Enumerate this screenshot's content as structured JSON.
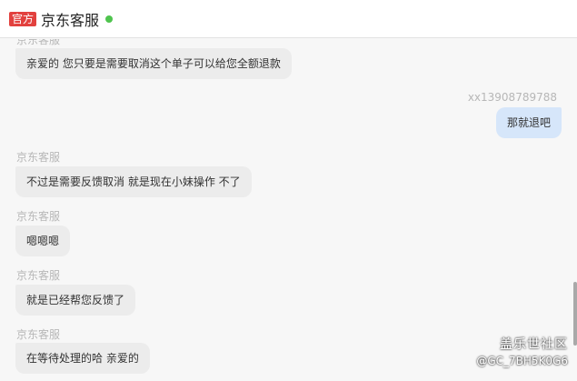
{
  "header": {
    "badge": "官方",
    "title": "京东客服",
    "status_color": "#4fc44e"
  },
  "messages": [
    {
      "sender": "京东客服",
      "text": "亲爱的 您只要是需要取消这个单子可以给您全额退款",
      "side": "left"
    },
    {
      "sender": "xx13908789788",
      "text": "那就退吧",
      "side": "right"
    },
    {
      "sender": "京东客服",
      "text": "不过是需要反馈取消 就是现在小妹操作 不了",
      "side": "left"
    },
    {
      "sender": "京东客服",
      "text": "嗯嗯嗯",
      "side": "left"
    },
    {
      "sender": "京东客服",
      "text": "就是已经帮您反馈了",
      "side": "left"
    },
    {
      "sender": "京东客服",
      "text": "在等待处理的哈 亲爱的",
      "side": "left"
    }
  ],
  "watermark": {
    "title": "盖乐世社区",
    "user": "@GC_7BH5K0G6"
  }
}
